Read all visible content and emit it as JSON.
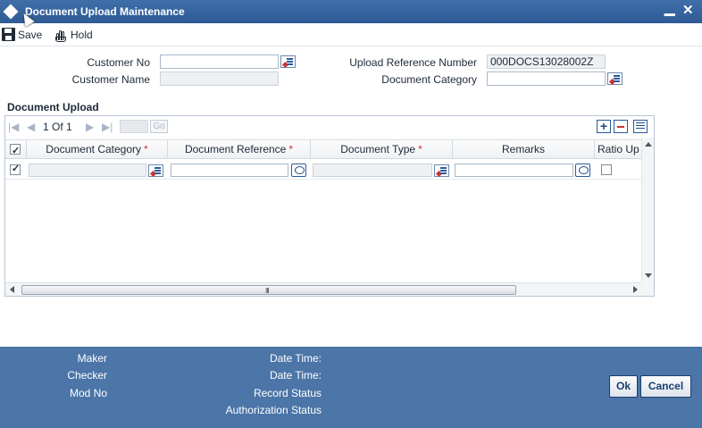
{
  "window": {
    "title": "Document Upload Maintenance",
    "minimize": "▁",
    "close": "✕"
  },
  "toolbar": {
    "save_label": "Save",
    "hold_label": "Hold"
  },
  "form": {
    "customer_no_label": "Customer No",
    "customer_no_value": "",
    "customer_name_label": "Customer Name",
    "customer_name_value": "",
    "upload_ref_label": "Upload Reference Number",
    "upload_ref_value": "000DOCS13028002Z",
    "doc_category_label": "Document Category",
    "doc_category_value": ""
  },
  "grid": {
    "section_title": "Document Upload",
    "page_current": "1",
    "page_of": "Of",
    "page_total": "1",
    "go_label": "Go",
    "required_mark": "*",
    "columns": [
      {
        "label": "Document Category",
        "required": true
      },
      {
        "label": "Document Reference",
        "required": true
      },
      {
        "label": "Document Type",
        "required": true
      },
      {
        "label": "Remarks",
        "required": false
      },
      {
        "label": "Ratio Up",
        "required": false
      }
    ],
    "scroll_grip": "III"
  },
  "footer": {
    "maker_label": "Maker",
    "checker_label": "Checker",
    "mod_no_label": "Mod No",
    "date_time_label_1": "Date Time:",
    "date_time_label_2": "Date Time:",
    "record_status_label": "Record Status",
    "auth_status_label": "Authorization Status",
    "ok_label": "Ok",
    "cancel_label": "Cancel"
  },
  "colors": {
    "titlebar": "#2f5b95",
    "footer": "#4c75a8",
    "required": "#d42f2f"
  }
}
